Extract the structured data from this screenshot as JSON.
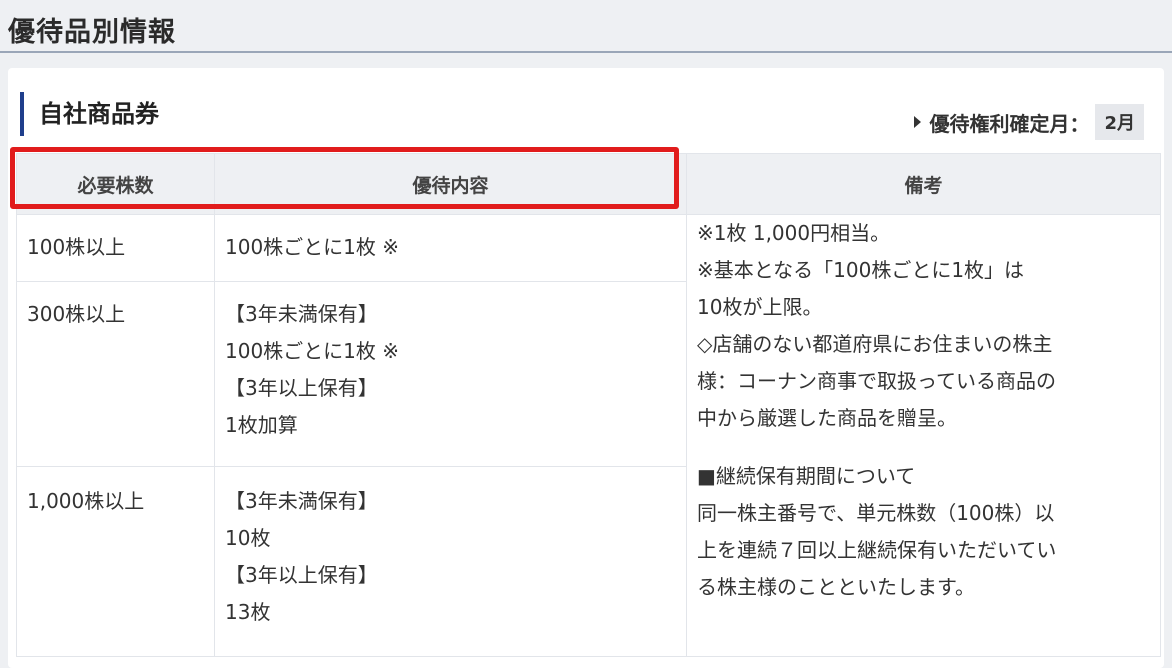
{
  "page": {
    "title": "優待品別情報"
  },
  "section": {
    "title": "自社商品券",
    "confirm_label": "優待権利確定月",
    "confirm_colon": "：",
    "confirm_month": "2月"
  },
  "table": {
    "headers": [
      "必要株数",
      "優待内容",
      "備考"
    ],
    "rows": [
      {
        "shares": "100株以上",
        "content": [
          "100株ごとに1枚 ※"
        ]
      },
      {
        "shares": "300株以上",
        "content": [
          "【3年未満保有】",
          "100株ごとに1枚 ※",
          "【3年以上保有】",
          "1枚加算"
        ]
      },
      {
        "shares": "1,000株以上",
        "content": [
          "【3年未満保有】",
          "10枚",
          "【3年以上保有】",
          "13枚"
        ]
      }
    ],
    "remarks": [
      "※1枚 1,000円相当。",
      "※基本となる「100株ごとに1枚」は",
      "10枚が上限。",
      "◇店舗のない都道府県にお住まいの株主",
      "様：コーナン商事で取扱っている商品の",
      "中から厳選した商品を贈呈。",
      "",
      "■継続保有期間について",
      "同一株主番号で、単元株数（100株）以",
      "上を連続７回以上継続保有いただいてい",
      "る株主様のことといたします。"
    ]
  },
  "colors": {
    "accent": "#1f3e8c",
    "highlight": "#e11c1c",
    "header_bg": "#eef0f3"
  }
}
